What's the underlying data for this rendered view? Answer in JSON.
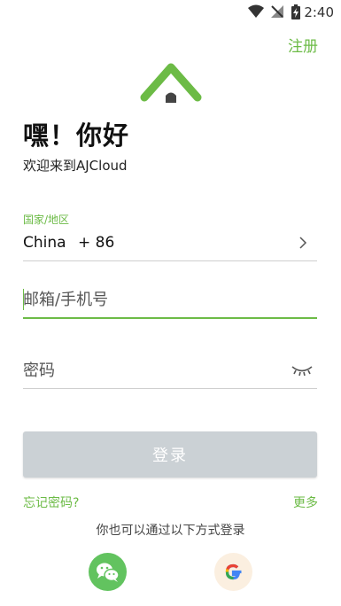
{
  "status_bar": {
    "time": "2:40"
  },
  "header": {
    "register_label": "注册"
  },
  "greeting": {
    "title": "嘿！你好",
    "subtitle": "欢迎来到AJCloud"
  },
  "region": {
    "label": "国家/地区",
    "country": "China",
    "code": "+ 86"
  },
  "account": {
    "placeholder": "邮箱/手机号"
  },
  "password": {
    "placeholder": "密码"
  },
  "login": {
    "label": "登录"
  },
  "links": {
    "forgot": "忘记密码?",
    "more": "更多"
  },
  "social": {
    "prompt": "你也可以通过以下方式登录",
    "icons": [
      "wechat-icon",
      "google-icon"
    ]
  },
  "colors": {
    "accent": "#6cbb46",
    "button_disabled": "#cbd1d5",
    "wechat": "#62c35f",
    "google_bg": "#fbefe0"
  }
}
